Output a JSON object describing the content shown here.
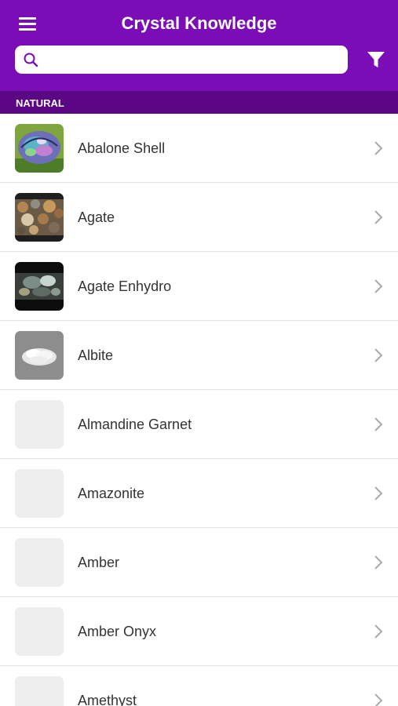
{
  "header": {
    "title": "Crystal Knowledge",
    "search_placeholder": "",
    "search_value": ""
  },
  "section": {
    "title": "NATURAL"
  },
  "items": [
    {
      "label": "Abalone Shell",
      "thumb": "abalone-shell-photo"
    },
    {
      "label": "Agate",
      "thumb": "agate-photo"
    },
    {
      "label": "Agate Enhydro",
      "thumb": "agate-enhydro-photo"
    },
    {
      "label": "Albite",
      "thumb": "albite-photo"
    },
    {
      "label": "Almandine Garnet",
      "thumb": "placeholder"
    },
    {
      "label": "Amazonite",
      "thumb": "placeholder"
    },
    {
      "label": "Amber",
      "thumb": "placeholder"
    },
    {
      "label": "Amber Onyx",
      "thumb": "placeholder"
    },
    {
      "label": "Amethyst",
      "thumb": "placeholder"
    }
  ],
  "colors": {
    "header_bg": "#7b0db6",
    "section_bg": "#5a0685",
    "divider": "#e2e2e2",
    "chevron": "#aaaaaa"
  }
}
